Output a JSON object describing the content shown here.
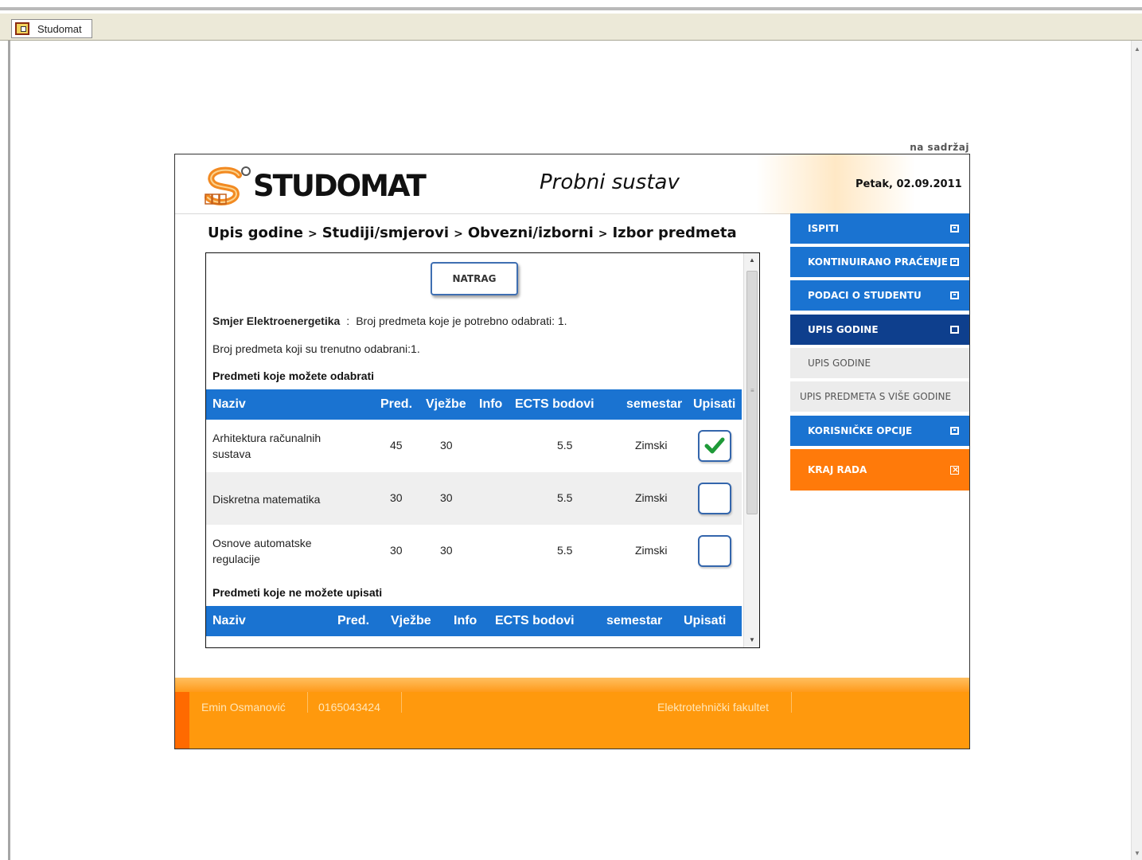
{
  "taskbar": {
    "window_label": "Studomat"
  },
  "skip_link": "na sadržaj",
  "header": {
    "logo_text": "STUDOMAT",
    "system_title": "Probni sustav",
    "date": "Petak, 02.09.2011"
  },
  "breadcrumb": [
    "Upis godine",
    "Studiji/smjerovi",
    "Obvezni/izborni",
    "Izbor predmeta"
  ],
  "breadcrumb_sep": ">",
  "content": {
    "back_button": "NATRAG",
    "direction_label": "Smjer Elektroenergetika",
    "direction_sep": ":",
    "required_text": "Broj predmeta koje je potrebno odabrati: 1.",
    "selected_text": "Broj predmeta koji su trenutno odabrani:1.",
    "available_title": "Predmeti koje možete odabrati",
    "unavailable_title": "Predmeti koje ne možete upisati",
    "columns": {
      "name": "Naziv",
      "lectures": "Pred.",
      "exercises": "Vježbe",
      "info": "Info",
      "ects": "ECTS bodovi",
      "semester": "semestar",
      "enroll": "Upisati"
    },
    "courses": [
      {
        "name_line1": "Arhitektura računalnih",
        "name_line2": "sustava",
        "lectures": "45",
        "exercises": "30",
        "ects": "5.5",
        "semester": "Zimski",
        "checked": true
      },
      {
        "name_line1": "Diskretna matematika",
        "name_line2": "",
        "lectures": "30",
        "exercises": "30",
        "ects": "5.5",
        "semester": "Zimski",
        "checked": false
      },
      {
        "name_line1": "Osnove automatske",
        "name_line2": "regulacije",
        "lectures": "30",
        "exercises": "30",
        "ects": "5.5",
        "semester": "Zimski",
        "checked": false
      }
    ]
  },
  "nav": {
    "items": [
      {
        "label": "ISPITI"
      },
      {
        "label": "KONTINUIRANO PRAĆENJE"
      },
      {
        "label": "PODACI O STUDENTU"
      },
      {
        "label": "UPIS GODINE"
      },
      {
        "label": "UPIS GODINE"
      },
      {
        "label": "UPIS PREDMETA S VIŠE GODINE"
      },
      {
        "label": "KORISNIČKE OPCIJE"
      },
      {
        "label": "KRAJ RADA"
      }
    ]
  },
  "footer": {
    "student_name": "Emin Osmanović",
    "student_id": "0165043424",
    "faculty": "Elektrotehnički fakultet"
  },
  "colors": {
    "accent_blue": "#1a73d1",
    "active_blue": "#0e3f8d",
    "orange": "#ff990d",
    "check_green": "#1e9a38"
  },
  "icons": [
    "window-icon",
    "dropdown-icon",
    "check-icon",
    "close-box-icon"
  ]
}
